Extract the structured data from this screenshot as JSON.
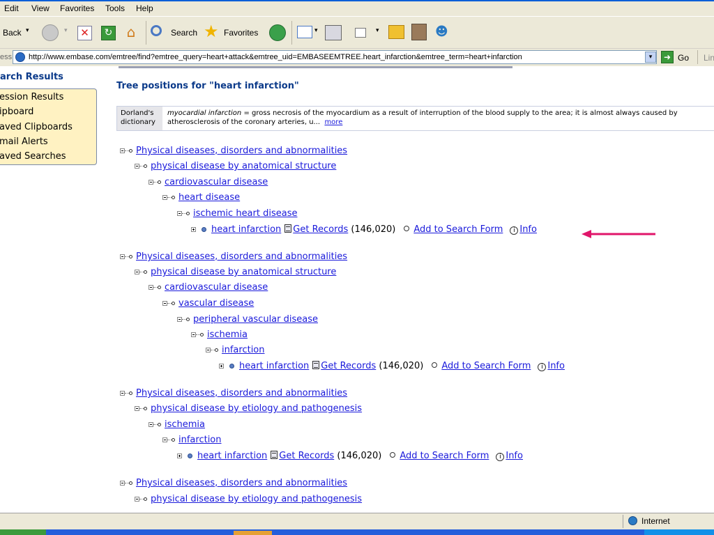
{
  "menu": [
    "Edit",
    "View",
    "Favorites",
    "Tools",
    "Help"
  ],
  "toolbar": {
    "back": "Back",
    "search": "Search",
    "favorites": "Favorites"
  },
  "address": {
    "label": "ess",
    "url": "http://www.embase.com/emtree/find?emtree_query=heart+attack&emtree_uid=EMBASEEMTREE.heart_infarction&emtree_term=heart+infarction",
    "go": "Go",
    "links": "Lin"
  },
  "sidebar": {
    "title": "arch Results",
    "items": [
      "ession Results",
      "ipboard",
      "aved Clipboards",
      "mail Alerts",
      "aved Searches"
    ]
  },
  "main": {
    "title": "Tree positions for \"heart infarction\"",
    "dorland": {
      "label_line1": "Dorland's",
      "label_line2": "dictionary",
      "term": "myocardial infarction",
      "definition": " = gross necrosis of the myocardium as a result of interruption of the blood supply to the area; it is almost always caused by atherosclerosis of the coronary arteries, u...",
      "more": "more"
    }
  },
  "tree": {
    "t0": "Physical diseases, disorders and abnormalities",
    "t1": "physical disease by anatomical structure",
    "t2": "cardiovascular disease",
    "t3": "heart disease",
    "t4": "ischemic heart disease",
    "t5": "heart infarction",
    "t6": "Physical diseases, disorders and abnormalities",
    "t7": "physical disease by anatomical structure",
    "t8": "cardiovascular disease",
    "t9": "vascular disease",
    "t10": "peripheral vascular disease",
    "t11": "ischemia",
    "t12": "infarction",
    "t13": "heart infarction",
    "t14": "Physical diseases, disorders and abnormalities",
    "t15": "physical disease by etiology and pathogenesis",
    "t16": "ischemia",
    "t17": "infarction",
    "t18": "heart infarction",
    "t19": "Physical diseases, disorders and abnormalities",
    "t20": "physical disease by etiology and pathogenesis"
  },
  "leaf_actions": {
    "get_records": "Get Records",
    "count": "(146,020)",
    "add": "Add to Search Form",
    "info": "Info"
  },
  "status": {
    "zone": "Internet"
  },
  "colors": {
    "link": "#1a1adb",
    "heading": "#0b3a8a",
    "arrow": "#e0156a",
    "sidebar_bg": "#fff2c2"
  }
}
